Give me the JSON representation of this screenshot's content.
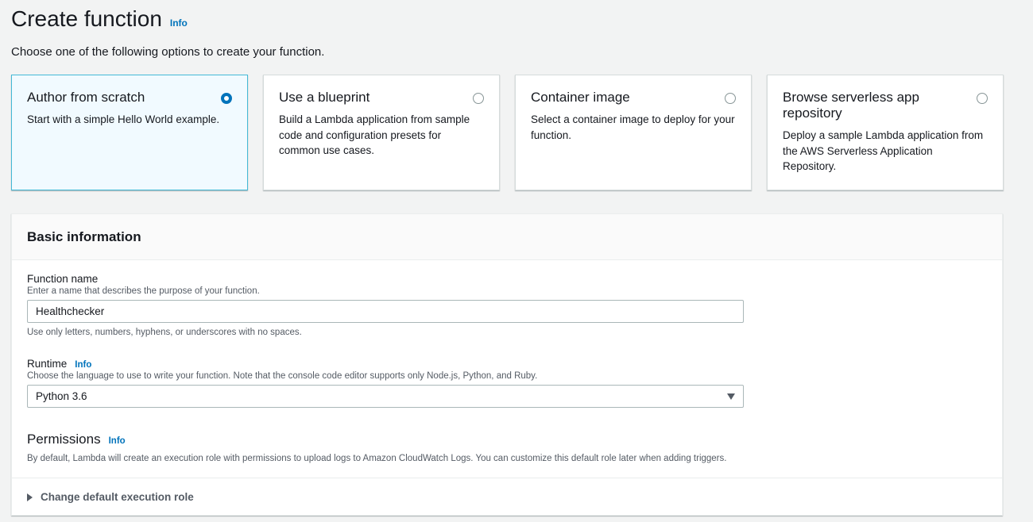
{
  "header": {
    "title": "Create function",
    "info": "Info",
    "subtitle": "Choose one of the following options to create your function."
  },
  "options": [
    {
      "title": "Author from scratch",
      "description": "Start with a simple Hello World example.",
      "selected": true
    },
    {
      "title": "Use a blueprint",
      "description": "Build a Lambda application from sample code and configuration presets for common use cases.",
      "selected": false
    },
    {
      "title": "Container image",
      "description": "Select a container image to deploy for your function.",
      "selected": false
    },
    {
      "title": "Browse serverless app repository",
      "description": "Deploy a sample Lambda application from the AWS Serverless Application Repository.",
      "selected": false
    }
  ],
  "basic_info": {
    "title": "Basic information",
    "function_name": {
      "label": "Function name",
      "description": "Enter a name that describes the purpose of your function.",
      "value": "Healthchecker",
      "hint": "Use only letters, numbers, hyphens, or underscores with no spaces."
    },
    "runtime": {
      "label": "Runtime",
      "info": "Info",
      "description": "Choose the language to use to write your function. Note that the console code editor supports only Node.js, Python, and Ruby.",
      "value": "Python 3.6"
    },
    "permissions": {
      "label": "Permissions",
      "info": "Info",
      "description": "By default, Lambda will create an execution role with permissions to upload logs to Amazon CloudWatch Logs. You can customize this default role later when adding triggers."
    },
    "expander_label": "Change default execution role"
  },
  "colors": {
    "link": "#0073bb",
    "selected_border": "#44b9d6",
    "selected_bg": "#f1faff"
  }
}
